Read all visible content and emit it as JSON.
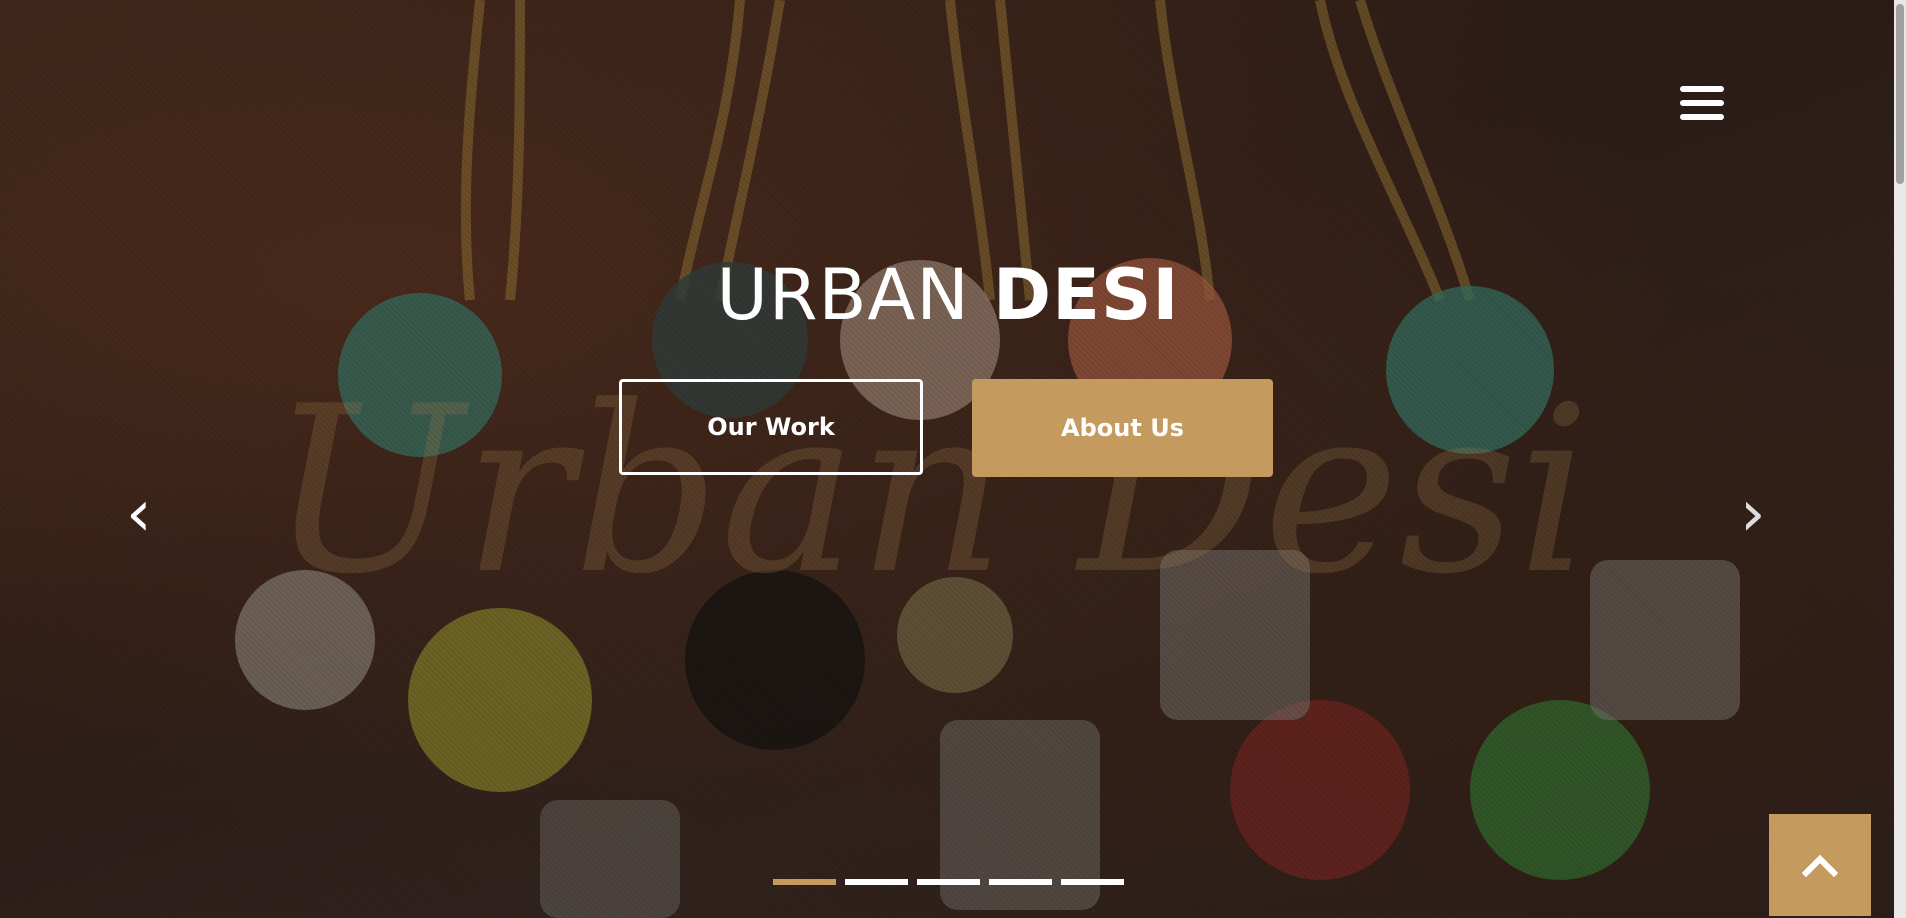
{
  "brand": {
    "title_light": "URBAN",
    "title_bold": "DESI",
    "watermark_script": "Urban Desi"
  },
  "hero": {
    "primary_button": "Our Work",
    "secondary_button": "About Us"
  },
  "carousel": {
    "prev_glyph": "‹",
    "next_glyph": "›",
    "slide_count": 5,
    "active_index": 0
  },
  "icons": {
    "menu": "hamburger-menu-icon",
    "prev": "chevron-left-icon",
    "next": "chevron-right-icon",
    "to_top": "chevron-up-icon"
  },
  "colors": {
    "accent": "#c49a5e",
    "text": "#ffffff"
  }
}
